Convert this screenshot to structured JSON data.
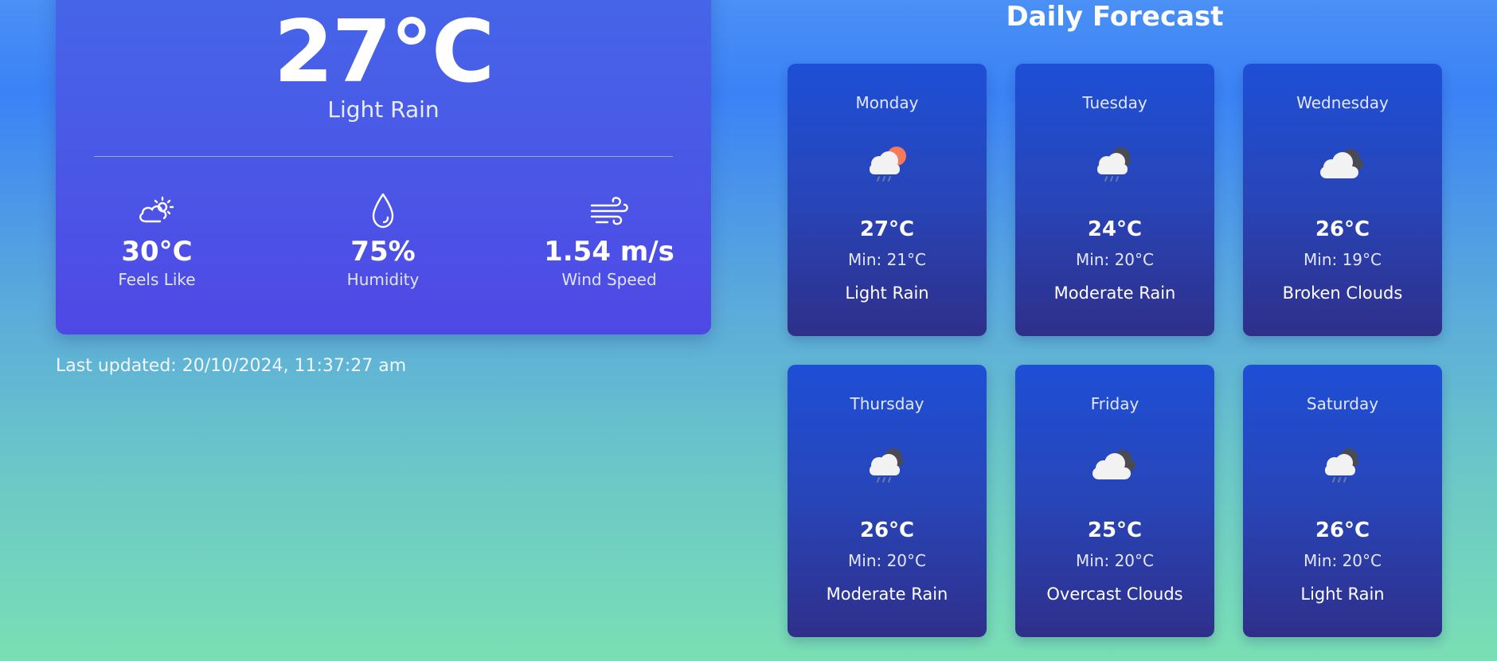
{
  "current": {
    "temperature": "27°C",
    "condition": "Light Rain",
    "stats": [
      {
        "icon": "partly-sunny-icon",
        "value": "30°C",
        "label": "Feels Like"
      },
      {
        "icon": "droplet-icon",
        "value": "75%",
        "label": "Humidity"
      },
      {
        "icon": "wind-icon",
        "value": "1.54 m/s",
        "label": "Wind Speed"
      }
    ]
  },
  "last_updated": "Last updated: 20/10/2024, 11:37:27 am",
  "forecast": {
    "title": "Daily Forecast",
    "days": [
      {
        "day": "Monday",
        "icon": "rain-sun-icon",
        "temp": "27°C",
        "min": "Min: 21°C",
        "condition": "Light Rain"
      },
      {
        "day": "Tuesday",
        "icon": "rain-cloud-icon",
        "temp": "24°C",
        "min": "Min: 20°C",
        "condition": "Moderate Rain"
      },
      {
        "day": "Wednesday",
        "icon": "broken-clouds-icon",
        "temp": "26°C",
        "min": "Min: 19°C",
        "condition": "Broken Clouds"
      },
      {
        "day": "Thursday",
        "icon": "rain-cloud-icon",
        "temp": "26°C",
        "min": "Min: 20°C",
        "condition": "Moderate Rain"
      },
      {
        "day": "Friday",
        "icon": "overcast-clouds-icon",
        "temp": "25°C",
        "min": "Min: 20°C",
        "condition": "Overcast Clouds"
      },
      {
        "day": "Saturday",
        "icon": "rain-cloud-icon",
        "temp": "26°C",
        "min": "Min: 20°C",
        "condition": "Light Rain"
      }
    ]
  }
}
